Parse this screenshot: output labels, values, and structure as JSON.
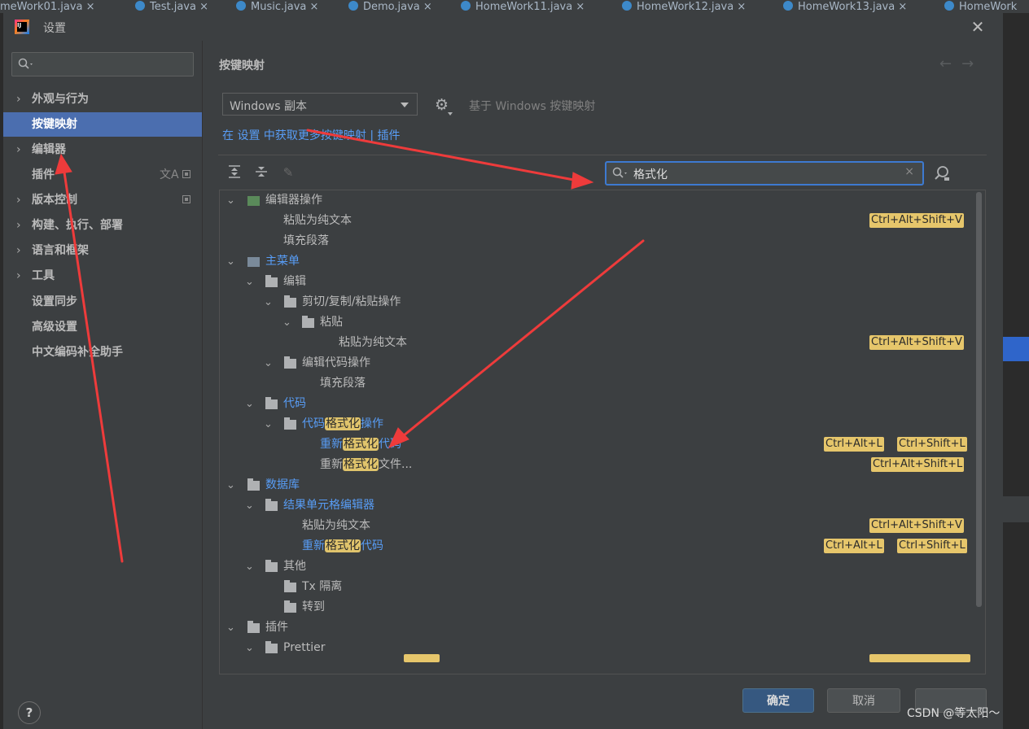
{
  "bg_tabs": [
    "meWork01.java",
    "Test.java",
    "Music.java",
    "Demo.java",
    "HomeWork11.java",
    "HomeWork12.java",
    "HomeWork13.java",
    "HomeWork"
  ],
  "dialog": {
    "title": "设置",
    "close_icon": "close-icon",
    "app_icon_text": "IJ"
  },
  "sidebar": {
    "search_placeholder": "",
    "items": [
      {
        "label": "外观与行为",
        "expandable": true
      },
      {
        "label": "按键映射",
        "expandable": false,
        "active": true
      },
      {
        "label": "编辑器",
        "expandable": true
      },
      {
        "label": "插件",
        "expandable": false
      },
      {
        "label": "版本控制",
        "expandable": true
      },
      {
        "label": "构建、执行、部署",
        "expandable": true
      },
      {
        "label": "语言和框架",
        "expandable": true
      },
      {
        "label": "工具",
        "expandable": true
      },
      {
        "label": "设置同步",
        "expandable": false
      },
      {
        "label": "高级设置",
        "expandable": false
      },
      {
        "label": "中文编码补全助手",
        "expandable": false
      }
    ]
  },
  "main": {
    "title": "按键映射",
    "keymap_select": "Windows 副本",
    "based_on": "基于 Windows 按键映射",
    "link_prefix": "在 ",
    "link_settings": "设置",
    "link_middle": " 中获取更多按键映射 ",
    "link_sep": "|",
    "link_plugins": " 插件",
    "search_value": "格式化",
    "clear_icon": "×"
  },
  "tree": [
    {
      "text": "编辑器操作",
      "blue": false
    },
    {
      "text": "粘贴为纯文本",
      "shortcuts": [
        "Ctrl+Alt+Shift+V"
      ]
    },
    {
      "text": "填充段落"
    },
    {
      "text": "主菜单",
      "blue": true
    },
    {
      "text": "编辑"
    },
    {
      "text": "剪切/复制/粘贴操作"
    },
    {
      "text": "粘贴"
    },
    {
      "text": "粘贴为纯文本",
      "shortcuts": [
        "Ctrl+Alt+Shift+V"
      ]
    },
    {
      "text": "编辑代码操作"
    },
    {
      "text": "填充段落"
    },
    {
      "text": "代码",
      "blue": true
    },
    {
      "pre": "代码",
      "hl": "格式化",
      "post": "操作",
      "blue": true
    },
    {
      "pre": "重新",
      "hl": "格式化",
      "post": "代码",
      "blue": true,
      "shortcuts": [
        "Ctrl+Alt+L",
        "Ctrl+Shift+L"
      ]
    },
    {
      "pre": "重新",
      "hl": "格式化",
      "post": "文件...",
      "blue": false,
      "shortcuts": [
        "Ctrl+Alt+Shift+L"
      ]
    },
    {
      "text": "数据库",
      "blue": true
    },
    {
      "text": "结果单元格编辑器",
      "blue": true
    },
    {
      "text": "粘贴为纯文本",
      "shortcuts": [
        "Ctrl+Alt+Shift+V"
      ]
    },
    {
      "pre": "重新",
      "hl": "格式化",
      "post": "代码",
      "blue": true,
      "shortcuts": [
        "Ctrl+Alt+L",
        "Ctrl+Shift+L"
      ]
    },
    {
      "text": "其他"
    },
    {
      "text": "Tx 隔离"
    },
    {
      "text": "转到"
    },
    {
      "text": "插件"
    },
    {
      "text": "Prettier"
    }
  ],
  "footer": {
    "help": "?",
    "ok": "确定",
    "cancel": "取消",
    "watermark": "CSDN @等太阳～"
  },
  "colors": {
    "accent": "#4b6eaf",
    "link": "#589df6",
    "highlight": "#e0c46c",
    "annotation_arrow": "#ee3b3b"
  }
}
